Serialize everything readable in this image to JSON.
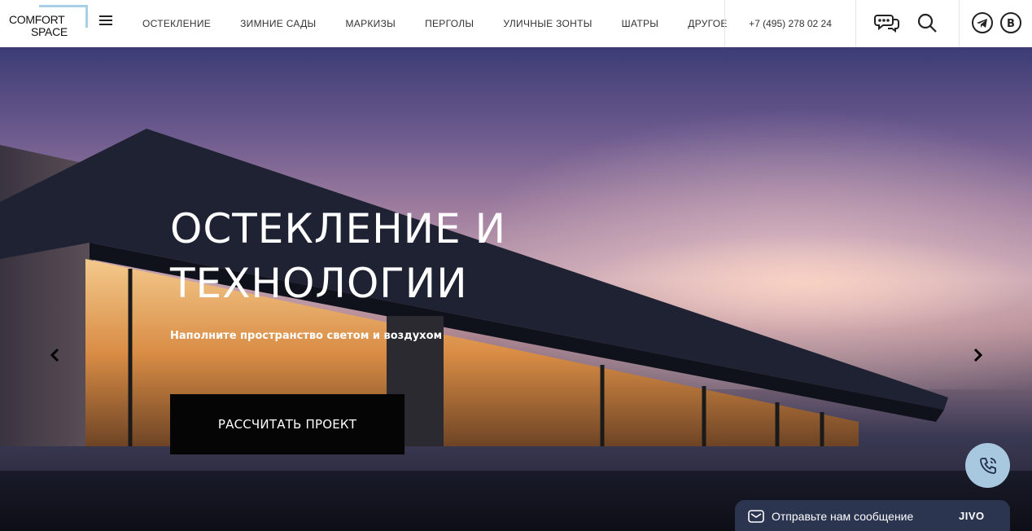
{
  "brand": {
    "line1": "COMFORT",
    "line2": "SPACE"
  },
  "nav": [
    {
      "label": "ОСТЕКЛЕНИЕ"
    },
    {
      "label": "ЗИМНИЕ САДЫ"
    },
    {
      "label": "МАРКИЗЫ"
    },
    {
      "label": "ПЕРГОЛЫ"
    },
    {
      "label": "УЛИЧНЫЕ ЗОНТЫ"
    },
    {
      "label": "ШАТРЫ"
    },
    {
      "label": "ДРУГОЕ"
    }
  ],
  "phone": "+7 (495) 278 02 24",
  "header_icons": [
    "chat-icon",
    "search-icon",
    "telegram-icon",
    "vk-icon"
  ],
  "hero": {
    "title_line1": "ОСТЕКЛЕНИЕ И",
    "title_line2": "ТЕХНОЛОГИИ",
    "subtitle": "Наполните пространство светом и воздухом",
    "cta_label": "РАССЧИТАТЬ ПРОЕКТ"
  },
  "widget": {
    "message": "Отправьте нам сообщение",
    "brand": "JIVO"
  },
  "colors": {
    "accent": "#a9cfe6",
    "cta_bg": "#050505",
    "widget_bg": "#2b3550",
    "call_bg": "#a8c8e0"
  }
}
